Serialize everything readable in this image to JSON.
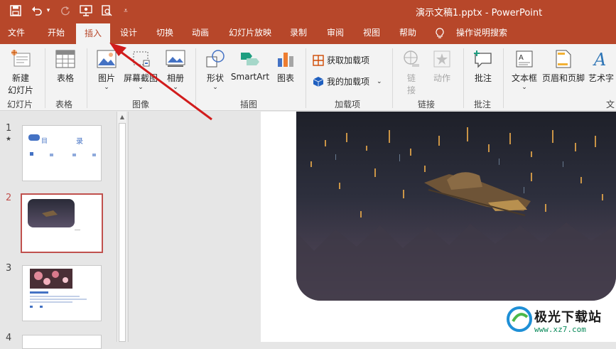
{
  "titlebar": {
    "doc_title": "演示文稿1.pptx  -  PowerPoint",
    "color": "#b7472a"
  },
  "tabs": [
    {
      "label": "文件"
    },
    {
      "label": "开始"
    },
    {
      "label": "插入"
    },
    {
      "label": "设计"
    },
    {
      "label": "切换"
    },
    {
      "label": "动画"
    },
    {
      "label": "幻灯片放映"
    },
    {
      "label": "录制"
    },
    {
      "label": "审阅"
    },
    {
      "label": "视图"
    },
    {
      "label": "帮助"
    },
    {
      "label": "操作说明搜索"
    }
  ],
  "ribbon": {
    "new_slide_label_1": "新建",
    "new_slide_label_2": "幻灯片",
    "table_label": "表格",
    "picture_label": "图片",
    "screenshot_label": "屏幕截图",
    "album_label": "相册",
    "shape_label": "形状",
    "smartart_label": "SmartArt",
    "chart_label": "图表",
    "get_addins_label": "获取加载项",
    "my_addins_label": "我的加载项",
    "link_label_1": "链",
    "link_label_2": "接",
    "action_label": "动作",
    "comment_label": "批注",
    "textbox_label": "文本框",
    "header_footer_label": "页眉和页脚",
    "wordart_label": "艺术字",
    "groups": {
      "slides": "幻灯片",
      "tables": "表格",
      "images": "图像",
      "illustrations": "插图",
      "addins": "加载项",
      "links": "链接",
      "comments": "批注",
      "text": "文"
    }
  },
  "slides": [
    {
      "number": "1",
      "star": "★",
      "title_left": "目",
      "title_right": "录"
    },
    {
      "number": "2"
    },
    {
      "number": "3"
    },
    {
      "number": "4"
    }
  ],
  "watermark": {
    "brand": "极光下载站",
    "url": "www.xz7.com"
  }
}
